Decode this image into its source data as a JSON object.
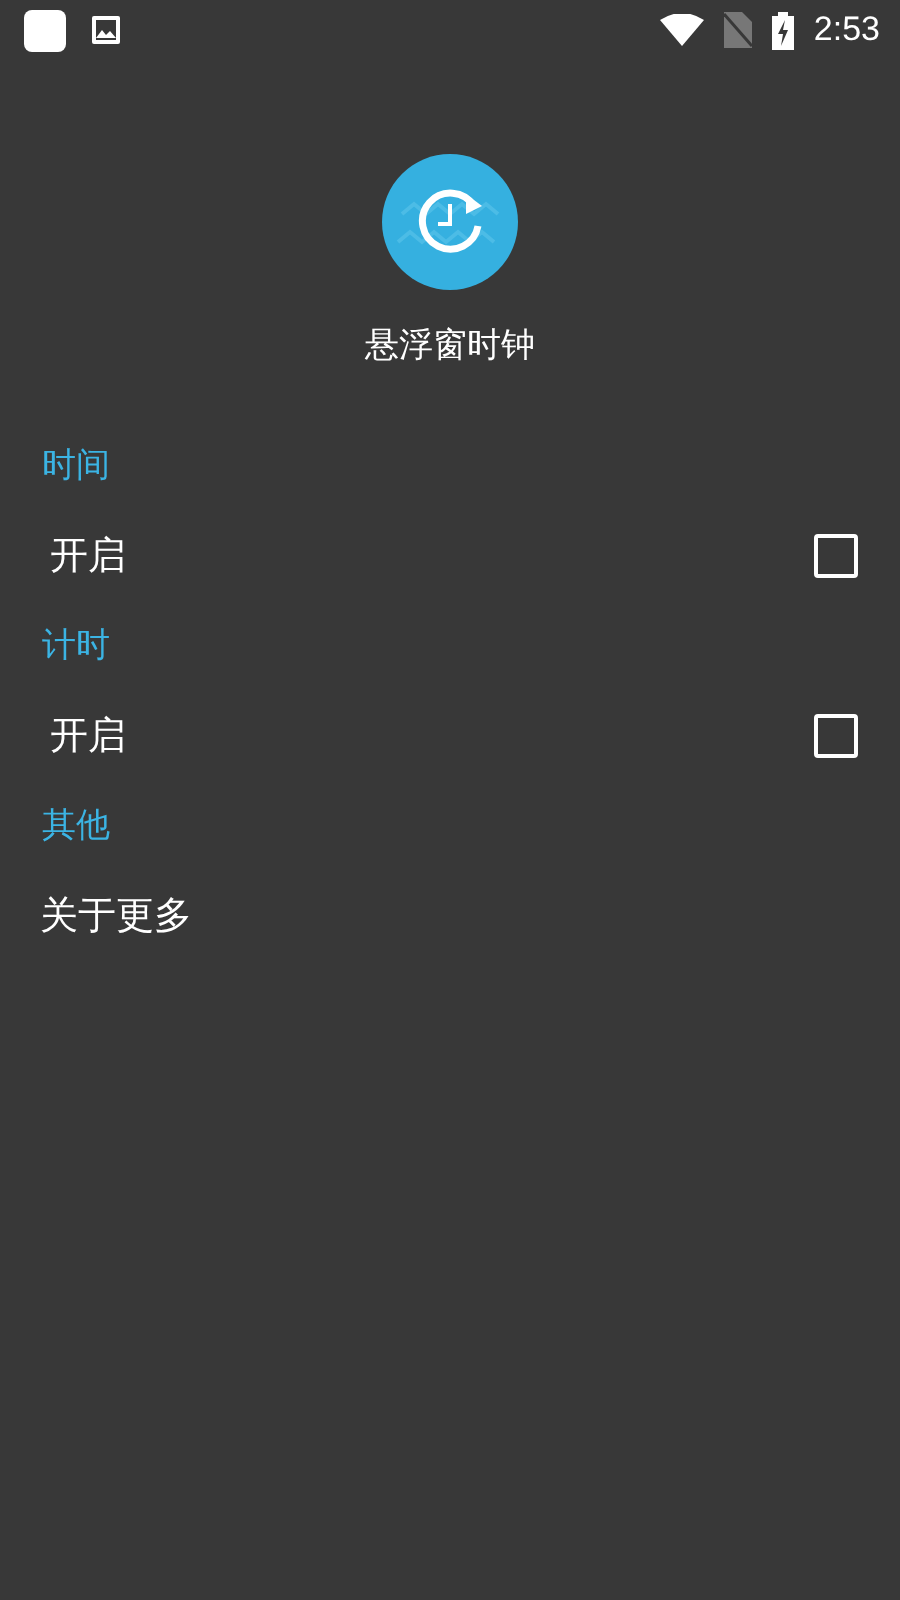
{
  "status_bar": {
    "time": "2:53"
  },
  "app": {
    "title": "悬浮窗时钟"
  },
  "sections": [
    {
      "header": "时间",
      "items": [
        {
          "kind": "checkbox",
          "label": "开启",
          "checked": false
        }
      ]
    },
    {
      "header": "计时",
      "items": [
        {
          "kind": "checkbox",
          "label": "开启",
          "checked": false
        }
      ]
    },
    {
      "header": "其他",
      "items": [
        {
          "kind": "link",
          "label": "关于更多"
        }
      ]
    }
  ]
}
